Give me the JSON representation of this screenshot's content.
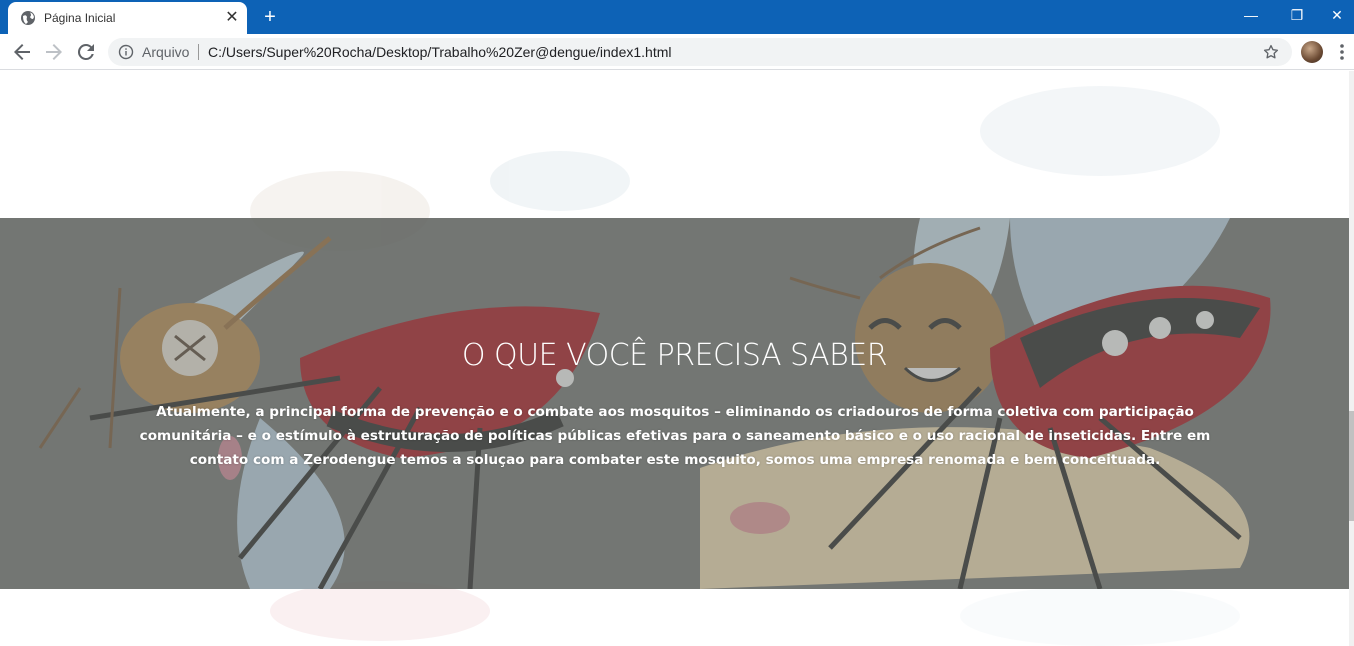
{
  "browser": {
    "tab": {
      "title": "Página Inicial",
      "close_glyph": "✕",
      "favicon": "globe-icon"
    },
    "new_tab_glyph": "+",
    "window_controls": {
      "minimize": "—",
      "maximize": "❐",
      "close": "✕"
    },
    "omnibox": {
      "scheme_label": "Arquivo",
      "url": "C:/Users/Super%20Rocha/Desktop/Trabalho%20Zer@dengue/index1.html"
    },
    "colors": {
      "titlebar": "#0d62b6",
      "omnibox": "#f1f3f4"
    }
  },
  "page": {
    "section": {
      "heading": "O QUE VOCÊ PRECISA SABER",
      "paragraph": "Atualmente, a principal forma de prevenção e o combate aos mosquitos – eliminando os criadouros de forma coletiva com participação comunitária – e o estímulo à estruturação de políticas públicas efetivas para o saneamento básico e o uso racional de inseticidas. Entre em contato com a Zerodengue temos a soluçao para combater este mosquito, somos uma empresa renomada e bem conceituada."
    },
    "colors": {
      "overlay": "#5c605c",
      "heading_text": "#ffffff"
    }
  }
}
